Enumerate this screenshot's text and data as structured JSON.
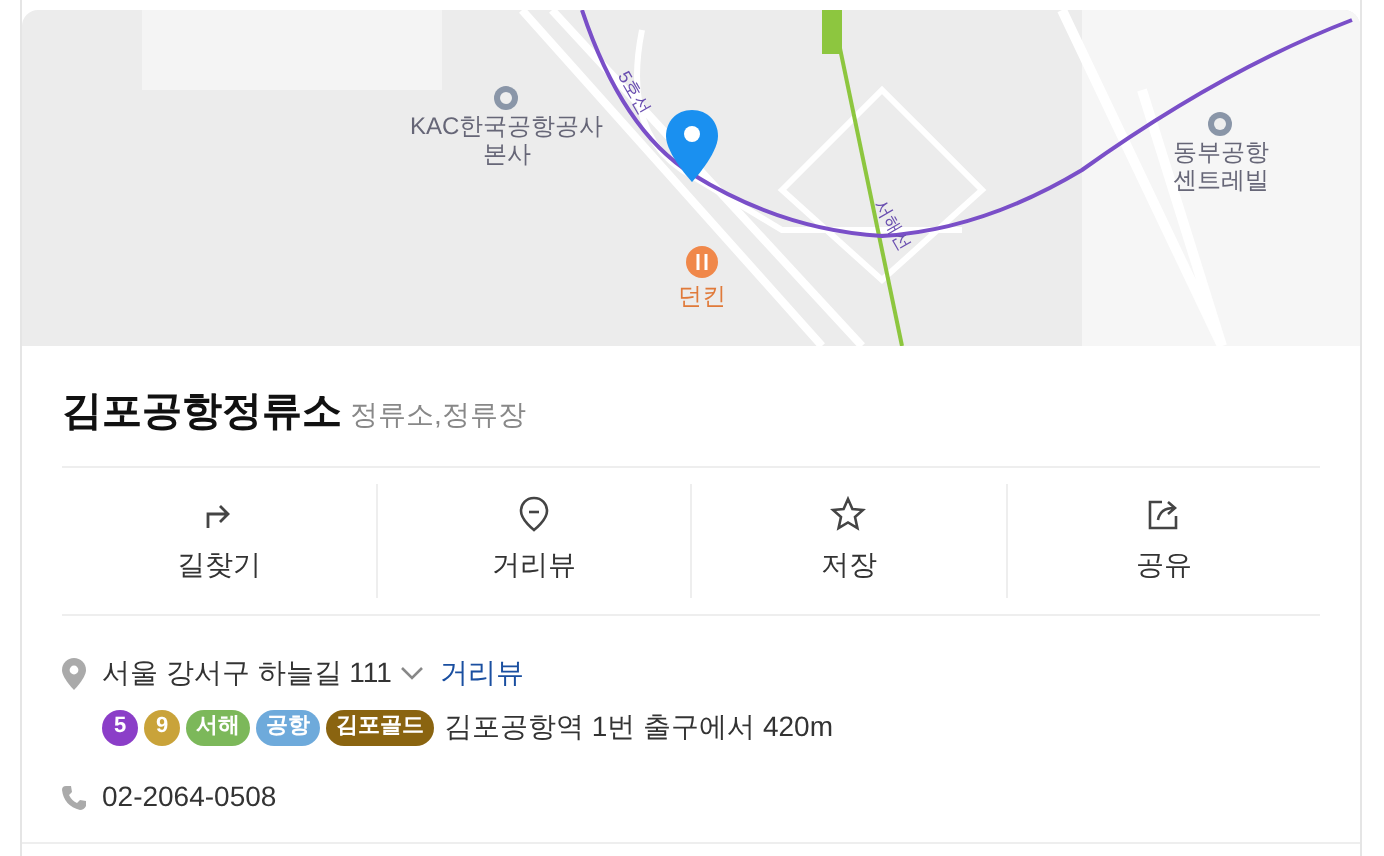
{
  "map": {
    "labels": [
      {
        "kind": "poi",
        "text": "KAC한국공항공사\n본사"
      },
      {
        "kind": "food",
        "text": "던킨"
      },
      {
        "kind": "poi",
        "text": "동부공항\n센트레빌"
      },
      {
        "kind": "line",
        "text": "5호선"
      },
      {
        "kind": "line",
        "text": "서해선"
      }
    ]
  },
  "place": {
    "name": "김포공항정류소",
    "category": "정류소,정류장"
  },
  "actions": [
    {
      "label": "길찾기"
    },
    {
      "label": "거리뷰"
    },
    {
      "label": "저장"
    },
    {
      "label": "공유"
    }
  ],
  "address": {
    "text": "서울 강서구 하늘길 111",
    "link": "거리뷰"
  },
  "subway": {
    "lines": [
      {
        "label": "5",
        "color": "#8b3ec8"
      },
      {
        "label": "9",
        "color": "#c9a33a"
      },
      {
        "label": "서해",
        "color": "#7cb85a"
      },
      {
        "label": "공항",
        "color": "#6eaadb"
      },
      {
        "label": "김포골드",
        "color": "#8a6410"
      }
    ],
    "text": "김포공항역 1번 출구에서 420m"
  },
  "phone": "02-2064-0508"
}
